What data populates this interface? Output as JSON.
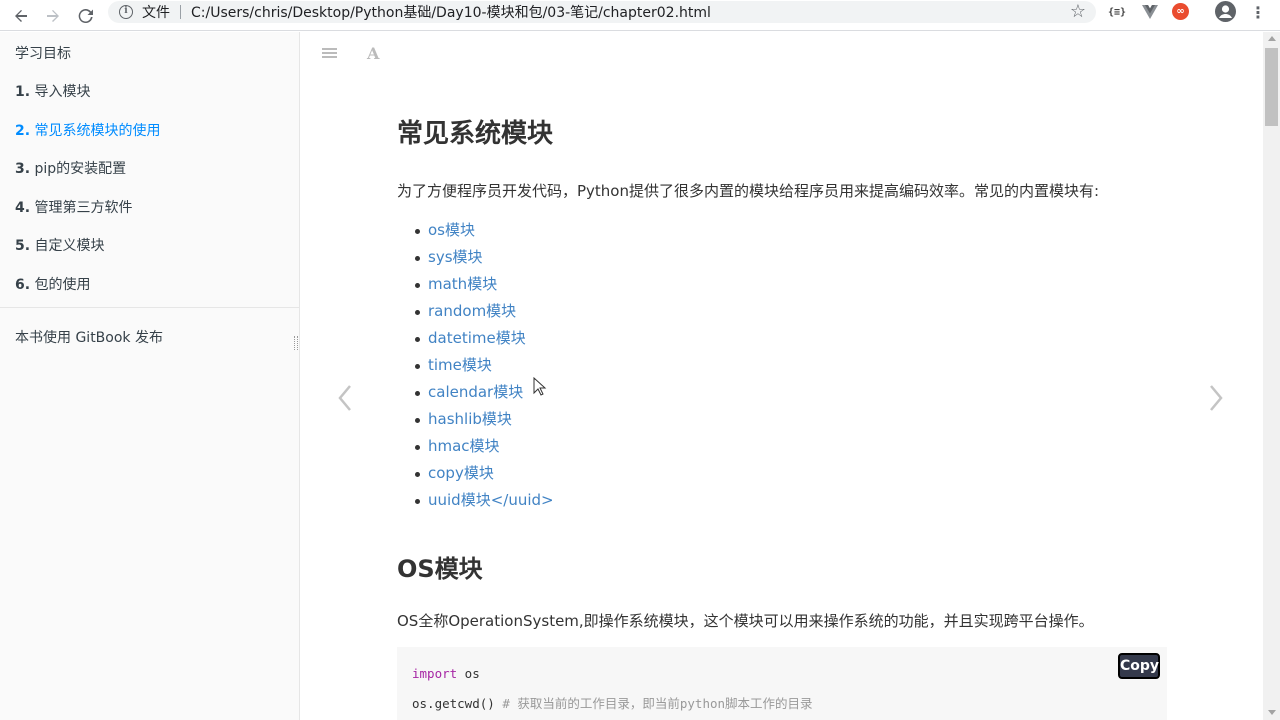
{
  "browser": {
    "scheme_label": "文件",
    "url": "C:/Users/chris/Desktop/Python基础/Day10-模块和包/03-笔记/chapter02.html",
    "ext_json_label": "{≡}",
    "ext_red_label": "∞"
  },
  "sidebar": {
    "items": [
      {
        "num": "",
        "label": "学习目标",
        "active": false
      },
      {
        "num": "1.",
        "label": "导入模块",
        "active": false
      },
      {
        "num": "2.",
        "label": "常见系统模块的使用",
        "active": true
      },
      {
        "num": "3.",
        "label": "pip的安装配置",
        "active": false
      },
      {
        "num": "4.",
        "label": "管理第三方软件",
        "active": false
      },
      {
        "num": "5.",
        "label": "自定义模块",
        "active": false
      },
      {
        "num": "6.",
        "label": "包的使用",
        "active": false
      }
    ],
    "footer": "本书使用 GitBook 发布"
  },
  "toolbar": {
    "font_label": "A"
  },
  "main": {
    "title": "常见系统模块",
    "intro": "为了方便程序员开发代码，Python提供了很多内置的模块给程序员用来提高编码效率。常见的内置模块有:",
    "modules": [
      "os模块",
      "sys模块",
      "math模块",
      "random模块",
      "datetime模块",
      "time模块",
      "calendar模块",
      "hashlib模块",
      "hmac模块",
      "copy模块",
      "uuid模块</uuid>"
    ],
    "section_title": "OS模块",
    "section_desc": "OS全称OperationSystem,即操作系统模块，这个模块可以用来操作系统的功能，并且实现跨平台操作。",
    "code": {
      "line1_kw": "import",
      "line1_rest": " os",
      "line2_code": "os.getcwd()",
      "line2_comment": "  # 获取当前的工作目录，即当前python脚本工作的目录"
    },
    "copy_label": "Copy"
  },
  "nav": {
    "prev": "‹",
    "next": "›"
  },
  "colors": {
    "link": "#4183c4",
    "active": "#008cff"
  }
}
